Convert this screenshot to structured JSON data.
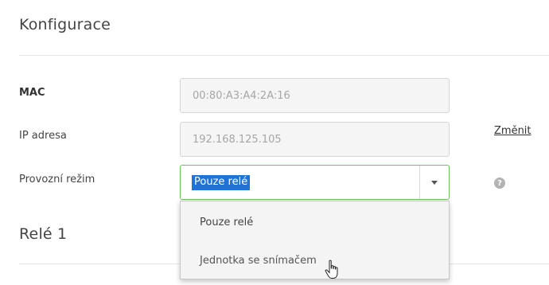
{
  "config_section": {
    "title": "Konfigurace"
  },
  "form": {
    "mac": {
      "label": "MAC",
      "value": "00:80:A3:A4:2A:16"
    },
    "ip": {
      "label": "IP adresa",
      "value": "192.168.125.105",
      "change_link": "Změnit"
    },
    "mode": {
      "label": "Provozní režim",
      "selected": "Pouze relé",
      "help_icon": "question-icon",
      "options": [
        "Pouze relé",
        "Jednotka se snímačem"
      ]
    }
  },
  "relay_section": {
    "title": "Relé 1"
  },
  "colors": {
    "selection_highlight": "#1f72d6",
    "focus_border": "#6fbf5b",
    "divider": "#e6e6e6"
  }
}
